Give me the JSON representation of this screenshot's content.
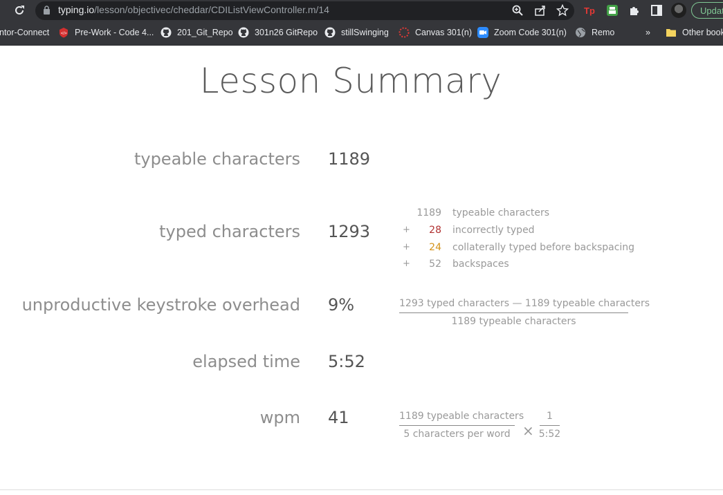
{
  "browser": {
    "url_host": "typing.io",
    "url_path": "/lesson/objectivec/cheddar/CDIListViewController.m/14",
    "update_label": "Updat",
    "bookmarks": [
      {
        "label": "ntor-Connect",
        "icon": "partial"
      },
      {
        "label": "Pre-Work - Code 4...",
        "icon": "code-fellows-icon"
      },
      {
        "label": "201_Git_Repo",
        "icon": "github-icon"
      },
      {
        "label": "301n26 GitRepo",
        "icon": "github-icon"
      },
      {
        "label": "stillSwinging",
        "icon": "github-icon"
      },
      {
        "label": "Canvas 301(n)",
        "icon": "canvas-icon"
      },
      {
        "label": "Zoom Code 301(n)",
        "icon": "zoom-icon"
      },
      {
        "label": "Remo",
        "icon": "globe-icon"
      }
    ],
    "overflow_label": "»",
    "other_bookmarks": "Other book"
  },
  "page": {
    "title": "Lesson Summary",
    "rows": {
      "typeable": {
        "label": "typeable characters",
        "value": "1189"
      },
      "typed": {
        "label": "typed characters",
        "value": "1293"
      },
      "overhead": {
        "label": "unproductive keystroke overhead",
        "value": "9%"
      },
      "elapsed": {
        "label": "elapsed time",
        "value": "5:52"
      },
      "wpm": {
        "label": "wpm",
        "value": "41"
      }
    },
    "breakdown": [
      {
        "op": "",
        "num": "1189",
        "text": "typeable characters",
        "color": "#999999"
      },
      {
        "op": "+",
        "num": "28",
        "text": "incorrectly typed",
        "color": "#b03030"
      },
      {
        "op": "+",
        "num": "24",
        "text": "collaterally typed before backspacing",
        "color": "#d4931a"
      },
      {
        "op": "+",
        "num": "52",
        "text": "backspaces",
        "color": "#999999"
      }
    ],
    "overhead_formula": {
      "numerator": "1293 typed characters — 1189 typeable characters",
      "denominator": "1189 typeable characters"
    },
    "wpm_formula": {
      "f1_numerator": "1189 typeable characters",
      "f1_denominator": "5 characters per word",
      "operator": "×",
      "f2_numerator": "1",
      "f2_denominator": "5:52"
    }
  }
}
